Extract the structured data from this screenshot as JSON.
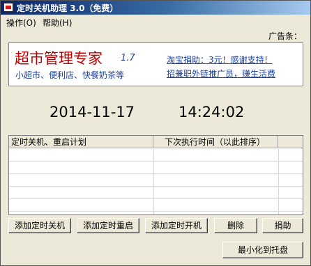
{
  "window": {
    "title": "定时关机助理 3.0（免费）"
  },
  "menu": {
    "items": [
      "操作(O)",
      "帮助(H)"
    ]
  },
  "ad": {
    "label": "广告条：",
    "title": "超市管理专家",
    "version": "1.7",
    "subtitle": "小超市、便利店、快餐奶茶等",
    "links": [
      "淘宝捐助：3元！感谢支持！",
      "招兼职外链推广员，赚生活费"
    ]
  },
  "clock": {
    "date": "2014-11-17",
    "time": "14:24:02"
  },
  "schedule_list": {
    "columns": [
      "定时关机、重启计划",
      "下次执行时间（以此排序）",
      ""
    ],
    "rows": []
  },
  "buttons": {
    "add_shutdown": "添加定时关机",
    "add_restart": "添加定时重启",
    "add_poweron": "添加定时开机",
    "delete": "删除",
    "donate": "捐助",
    "minimize_tray": "最小化到托盘"
  },
  "colors": {
    "ad_title": "#c00000",
    "ad_text": "#1a3f9c",
    "titlebar_start": "#0a246a",
    "window_bg": "#ece9d8"
  }
}
